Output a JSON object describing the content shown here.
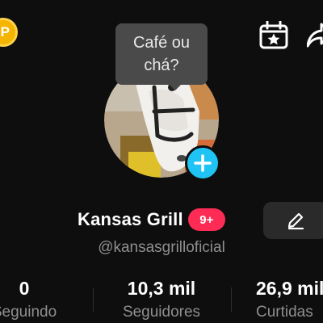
{
  "header": {
    "coin_icon": "coin-icon",
    "coin_symbol": "P",
    "calendar_icon": "calendar-star-icon",
    "share_icon": "share-icon"
  },
  "note_bubble": {
    "text": "Café ou\nchá?"
  },
  "profile": {
    "display_name": "Kansas Grill",
    "badge": "9+",
    "username": "@kansasgrilloficial",
    "edit_icon": "pencil-icon",
    "add_icon": "plus-icon"
  },
  "stats": [
    {
      "value": "0",
      "label": "Seguindo"
    },
    {
      "value": "10,3 mil",
      "label": "Seguidores"
    },
    {
      "value": "26,9 mil",
      "label": "Curtidas"
    }
  ],
  "colors": {
    "background": "#0e0e0e",
    "badge": "#fe2c55",
    "add_button": "#20c4f4",
    "coin": "#f5b400",
    "secondary_text": "#8f8f8f"
  }
}
